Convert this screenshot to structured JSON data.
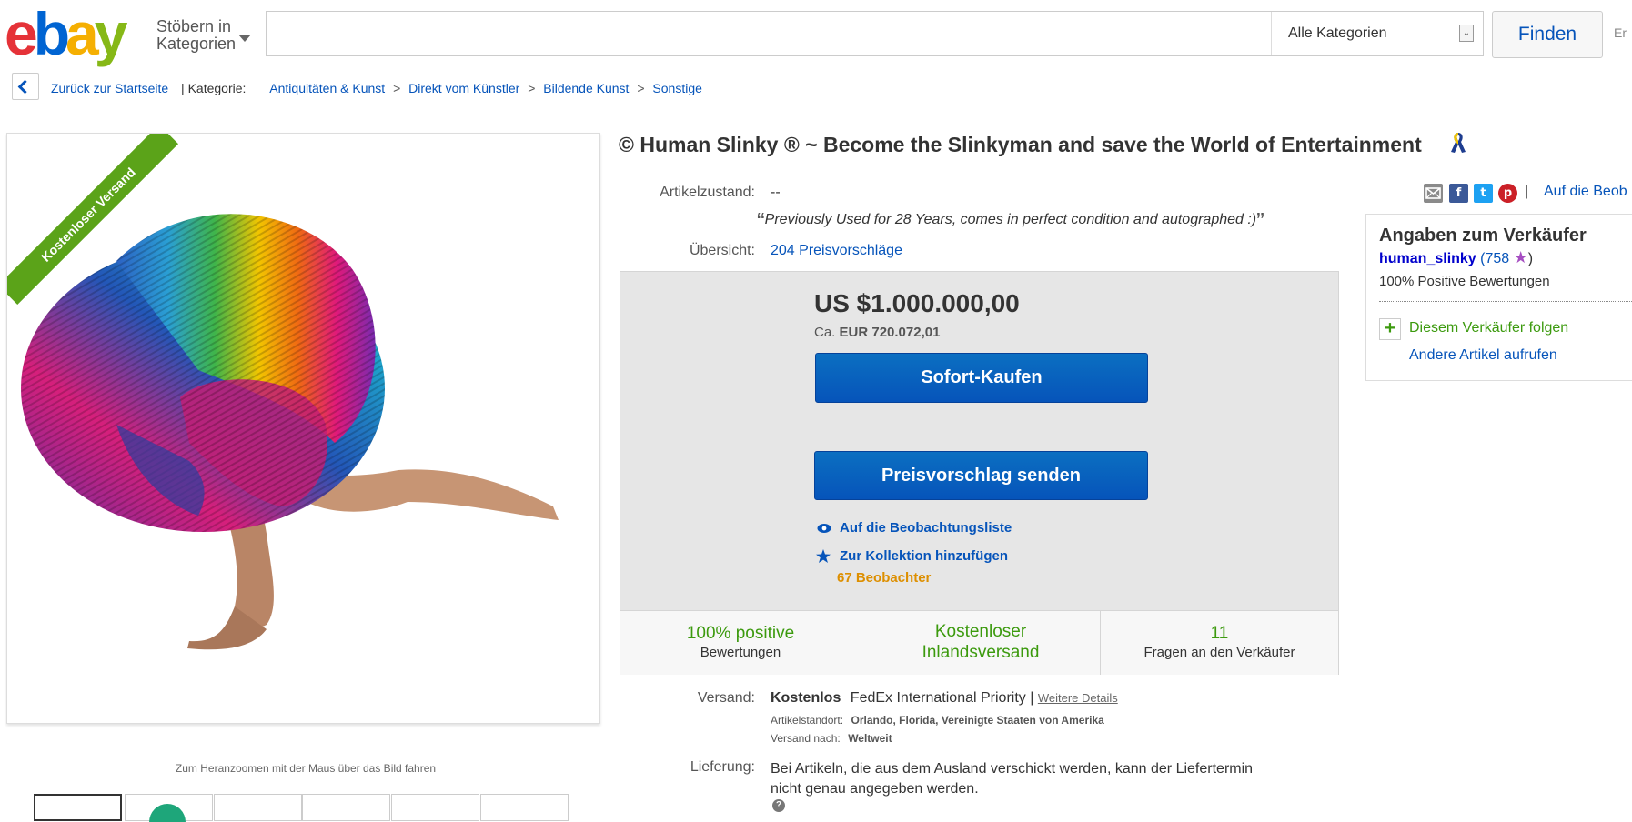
{
  "header": {
    "logo": {
      "e": "e",
      "b": "b",
      "a": "a",
      "y": "y"
    },
    "browse_label_1": "Stöbern in",
    "browse_label_2": "Kategorien",
    "search_placeholder": "",
    "category_select": "Alle Kategorien",
    "find_button": "Finden",
    "cut_text": "Er"
  },
  "breadcrumb": {
    "back_label": "Zurück zur Startseite",
    "category_label": "| Kategorie:",
    "items": [
      "Antiquitäten & Kunst",
      "Direkt vom Künstler",
      "Bildende Kunst",
      "Sonstige"
    ],
    "separator": ">"
  },
  "gallery": {
    "ribbon": "Kostenloser Versand",
    "zoom_hint": "Zum Heranzoomen mit der Maus über das Bild fahren"
  },
  "item": {
    "title": "© Human Slinky ® ~ Become the Slinkyman and save the World of Entertainment",
    "condition_label": "Artikelzustand:",
    "condition_value": "--",
    "condition_quote": "Previously Used for 28 Years, comes in perfect condition and autographed :)",
    "overview_label": "Übersicht:",
    "overview_value": "204 Preisvorschläge"
  },
  "buy_box": {
    "price": "US $1.000.000,00",
    "approx_prefix": "Ca.",
    "approx_value": "EUR 720.072,01",
    "buy_now": "Sofort-Kaufen",
    "make_offer": "Preisvorschlag senden",
    "watch_link": "Auf die Beobachtungsliste",
    "collection_link": "Zur Kollektion hinzufügen",
    "watchers": "67 Beobachter"
  },
  "stats": [
    {
      "top": "100% positive",
      "bottom": "Bewertungen"
    },
    {
      "top": "Kostenloser",
      "bottom": "Inlandsversand"
    },
    {
      "top": "11",
      "bottom": "Fragen an den Verkäufer"
    }
  ],
  "shipping": {
    "label": "Versand:",
    "cost": "Kostenlos",
    "method": "FedEx International Priority |",
    "details_link": "Weitere Details",
    "location_label": "Artikelstandort:",
    "location_value": "Orlando, Florida, Vereinigte Staaten von Amerika",
    "ships_to_label": "Versand nach:",
    "ships_to_value": "Weltweit",
    "delivery_label": "Lieferung:",
    "delivery_text_1": "Bei Artikeln, die aus dem Ausland verschickt werden, kann der Liefertermin",
    "delivery_text_2": "nicht genau angegeben werden.",
    "help_icon": "?"
  },
  "seller": {
    "watch_link_cut": "Auf die Beob",
    "title": "Angaben zum Verkäufer",
    "name": "human_slinky",
    "feedback_open": "(758",
    "feedback_close": ")",
    "positive": "100% Positive Bewertungen",
    "follow_icon": "+",
    "follow": "Diesem Verkäufer folgen",
    "other_items": "Andere Artikel aufrufen",
    "social": {
      "facebook": "f",
      "twitter": "t",
      "pinterest": "p",
      "separator": "|"
    }
  },
  "colors": {
    "link": "#0654ba",
    "green": "#3c9a0e",
    "orange": "#dd8f00",
    "button": "#0654ba",
    "ribbon": "#5ba319"
  }
}
